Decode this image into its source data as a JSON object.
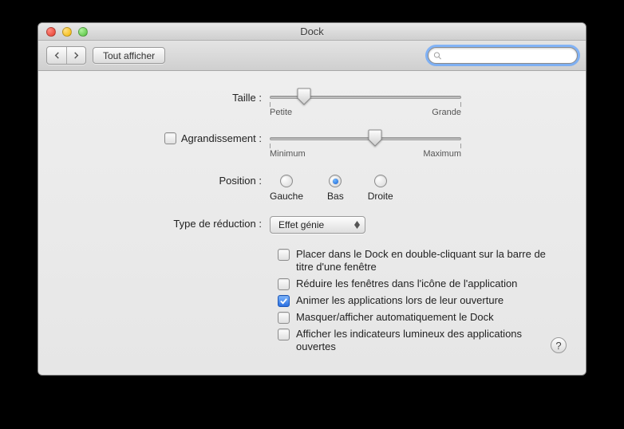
{
  "window": {
    "title": "Dock"
  },
  "toolbar": {
    "show_all_label": "Tout afficher",
    "search_placeholder": ""
  },
  "size": {
    "label": "Taille :",
    "min_label": "Petite",
    "max_label": "Grande",
    "value_percent": 18
  },
  "magnification": {
    "label": "Agrandissement :",
    "checked": false,
    "min_label": "Minimum",
    "max_label": "Maximum",
    "value_percent": 55
  },
  "position": {
    "label": "Position :",
    "options": [
      {
        "label": "Gauche",
        "selected": false
      },
      {
        "label": "Bas",
        "selected": true
      },
      {
        "label": "Droite",
        "selected": false
      }
    ]
  },
  "minimize_effect": {
    "label": "Type de réduction :",
    "selected": "Effet génie"
  },
  "checkboxes": [
    {
      "label": "Placer dans le Dock en double-cliquant sur la barre de titre d'une fenêtre",
      "checked": false
    },
    {
      "label": "Réduire les fenêtres dans l'icône de l'application",
      "checked": false
    },
    {
      "label": "Animer les applications lors de leur ouverture",
      "checked": true
    },
    {
      "label": "Masquer/afficher automatiquement le Dock",
      "checked": false
    },
    {
      "label": "Afficher les indicateurs lumineux des applications ouvertes",
      "checked": false
    }
  ],
  "help_label": "?"
}
